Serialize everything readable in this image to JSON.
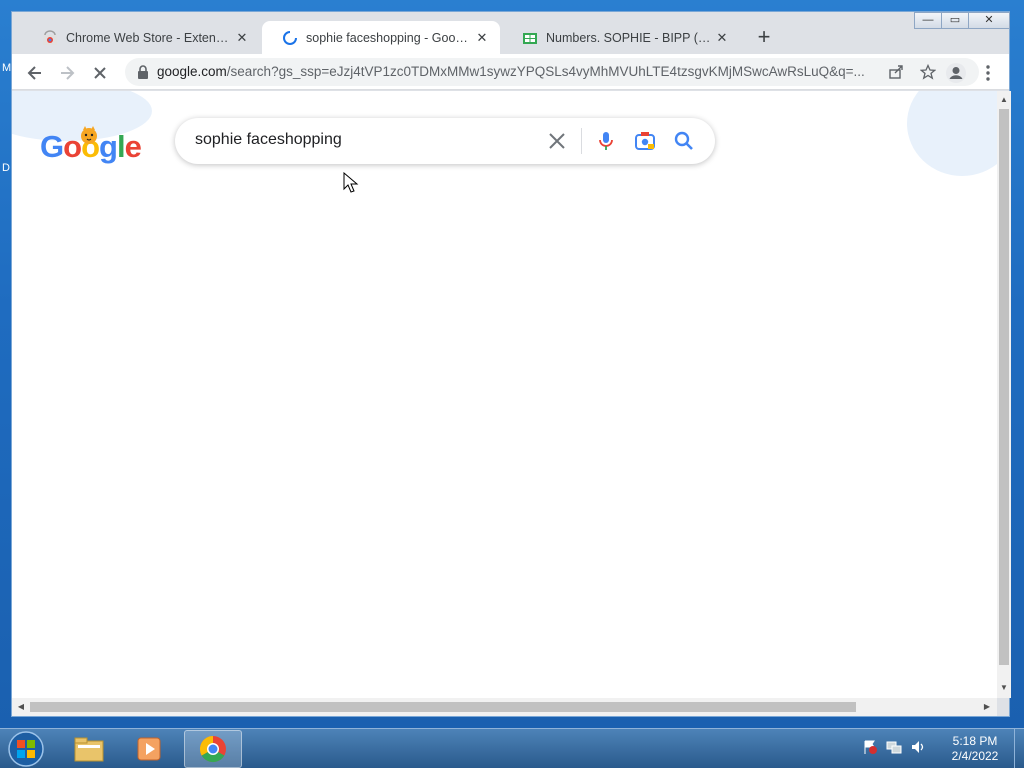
{
  "desktop": {
    "edge_letters": [
      "M",
      "D"
    ]
  },
  "browser": {
    "tabs": [
      {
        "title": "Chrome Web Store - Extensions",
        "close": "✕",
        "icon": "chrome-web-store-icon"
      },
      {
        "title": "sophie faceshopping - Google Search",
        "close": "✕",
        "icon": "loading-spinner-icon"
      },
      {
        "title": "Numbers. SOPHIE - BIPP (Autechre",
        "close": "✕",
        "icon": "sheets-icon"
      }
    ],
    "new_tab": "+",
    "window_controls": {
      "minimize": "—",
      "maximize": "▭",
      "close": "✕"
    },
    "url_host": "google.com",
    "url_path": "/search?gs_ssp=eJzj4tVP1zc0TDMxMMw1sywzYPQSLs4vyMhMVUhLTE4tzsgvKMjMSwcAwRsLuQ&q=..."
  },
  "page": {
    "logo_letters": [
      "G",
      "o",
      "o",
      "g",
      "l",
      "e"
    ],
    "logo_colors": [
      "#4285f4",
      "#ea4335",
      "#fbbc05",
      "#4285f4",
      "#34a853",
      "#ea4335"
    ],
    "search_query": "sophie faceshopping"
  },
  "taskbar": {
    "time": "5:18 PM",
    "date": "2/4/2022"
  }
}
